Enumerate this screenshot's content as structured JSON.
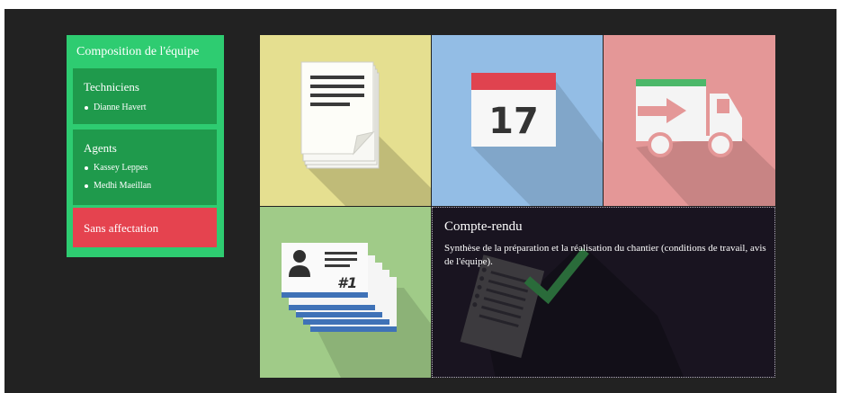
{
  "sidebar": {
    "title": "Composition de l'équipe",
    "groups": [
      {
        "title": "Techniciens",
        "members": [
          "Dianne Havert"
        ]
      },
      {
        "title": "Agents",
        "members": [
          "Kassey Leppes",
          "Medhi Maeillan"
        ]
      }
    ],
    "unassigned_label": "Sans affectation"
  },
  "tiles": {
    "calendar_day": "17",
    "card_number": "#1",
    "report": {
      "title": "Compte-rendu",
      "description": "Synthèse de la préparation et la réalisation du chantier (conditions de travail, avis de l'équipe)."
    }
  },
  "colors": {
    "sidebar_bg": "#2ecc71",
    "group_bg": "#1f9a4c",
    "unassigned_bg": "#e5434f",
    "tile_documents": "#e5df90",
    "tile_calendar": "#93bde5",
    "tile_delivery": "#e49797",
    "tile_cards": "#a0cb88",
    "tile_report": "#191420"
  }
}
